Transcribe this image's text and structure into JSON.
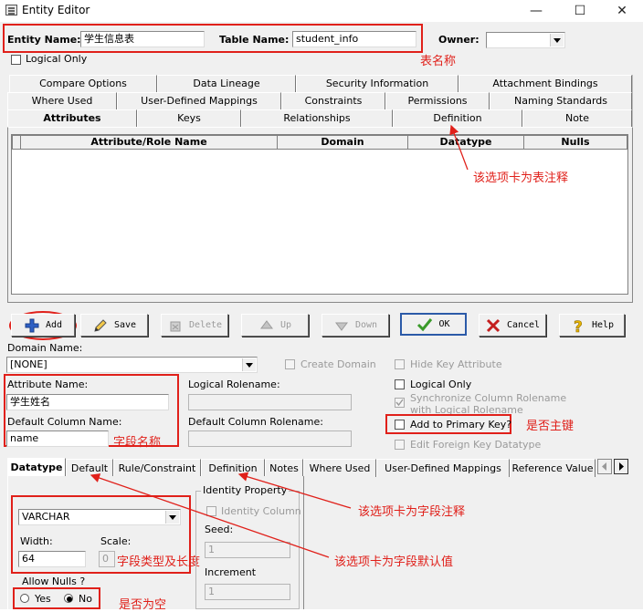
{
  "window": {
    "title": "Entity Editor",
    "minimize": "—",
    "maximize": "☐",
    "close": "✕"
  },
  "header": {
    "entity_name_label": "Entity Name:",
    "entity_name_value": "学生信息表",
    "table_name_label": "Table Name:",
    "table_name_value": "student_info",
    "owner_label": "Owner:",
    "owner_value": "",
    "logical_only_label": "Logical Only"
  },
  "tabs": {
    "row1": [
      "Compare Options",
      "Data Lineage",
      "Security Information",
      "Attachment Bindings"
    ],
    "row2": [
      "Where Used",
      "User-Defined Mappings",
      "Constraints",
      "Permissions",
      "Naming Standards"
    ],
    "row3": [
      "Attributes",
      "Keys",
      "Relationships",
      "Definition",
      "Note"
    ]
  },
  "grid": {
    "columns": [
      "Attribute/Role Name",
      "Domain",
      "Datatype",
      "Nulls"
    ]
  },
  "buttons": {
    "add": "Add",
    "save": "Save",
    "delete": "Delete",
    "up": "Up",
    "down": "Down",
    "ok": "OK",
    "cancel": "Cancel",
    "help": "Help"
  },
  "domain": {
    "label": "Domain Name:",
    "value": "[NONE]",
    "create_domain": "Create Domain",
    "hide_key": "Hide Key Attribute"
  },
  "attribute": {
    "name_label": "Attribute Name:",
    "name_value": "学生姓名",
    "column_label": "Default Column Name:",
    "column_value": "name",
    "logical_rolename_label": "Logical Rolename:",
    "column_rolename_label": "Default Column Rolename:"
  },
  "options": {
    "logical_only": "Logical Only",
    "sync_rolename_line1": "Synchronize Column Rolename",
    "sync_rolename_line2": "with Logical Rolename",
    "add_pk": "Add to Primary Key?",
    "edit_fk": "Edit Foreign Key Datatype"
  },
  "subtabs": [
    "Datatype",
    "Default",
    "Rule/Constraint",
    "Definition",
    "Notes",
    "Where Used",
    "User-Defined Mappings",
    "Reference Value"
  ],
  "datatype": {
    "type_value": "VARCHAR",
    "width_label": "Width:",
    "width_value": "64",
    "scale_label": "Scale:",
    "scale_value": "0",
    "allow_nulls_label": "Allow Nulls ?",
    "yes_label": "Yes",
    "no_label": "No",
    "identity_group": "Identity Property",
    "identity_column": "Identity Column",
    "seed_label": "Seed:",
    "seed_value": "1",
    "increment_label": "Increment",
    "increment_value": "1"
  },
  "annotations": {
    "table_name": "表名称",
    "table_comment": "该选项卡为表注释",
    "field_name": "字段名称",
    "primary_key": "是否主键",
    "field_comment": "该选项卡为字段注释",
    "field_default": "该选项卡为字段默认值",
    "field_type": "字段类型及长度",
    "nullable": "是否为空"
  },
  "colors": {
    "annotation": "#e0201a",
    "ok_check": "#3a9a2a",
    "add_plus": "#2e5fc4",
    "cancel_x": "#c41e1e",
    "help_q": "#e8b400"
  }
}
